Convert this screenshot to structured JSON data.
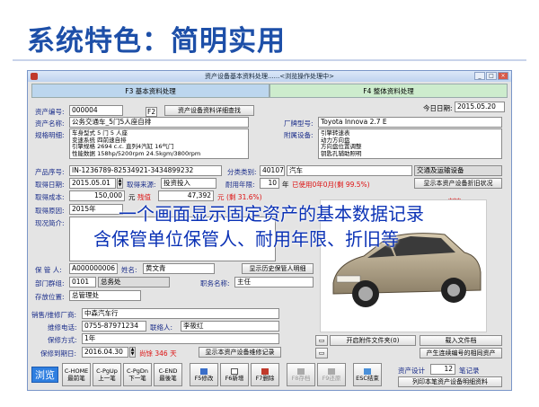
{
  "slide": {
    "title": "系统特色：简明实用"
  },
  "window": {
    "title": "资产设备基本资料处理......<浏览操作处理中>",
    "controls": [
      "_",
      "□",
      "×"
    ]
  },
  "tabs": {
    "basic": "F3 基本资料处理",
    "overall": "F4 整体资料处理"
  },
  "form": {
    "today_label": "今日日期:",
    "today_value": "2015.05.20",
    "asset_no_label": "资产编号:",
    "asset_no_value": "000004",
    "f2_label": "F2",
    "detail_query_btn": "资产设备资料详细查找",
    "asset_name_label": "资产名称:",
    "asset_name_value": "公务交通车_5门5人座自排",
    "brand_label": "厂牌型号:",
    "brand_value": "Toyota Innova 2.7 E",
    "spec_label": "规格明细:",
    "spec_lines": [
      "车身型式 5 门 5 人座",
      "变速系统 四前速自排",
      "引擎规格 2694 c.c. 直列4汽缸 16气门",
      "性能数据 158hp/5200rpm 24.5kgm/3800rpm"
    ],
    "accessory_label": "附属设备:",
    "accessory_lines": [
      "引擎转速表",
      "动力方向盘",
      "方向盘位置调整",
      "钥匙孔辅助照明"
    ],
    "serial_label": "产品序号:",
    "serial_value": "IN-1236789-82534921-3434899232",
    "category_label": "分类类别:",
    "category_code": "40107",
    "category_name": "汽车",
    "category_group": "交通及运输设备",
    "acq_date_label": "取得日期:",
    "acq_date_value": "2015.05.01",
    "acq_source_label": "取得来源:",
    "acq_source_value": "投资投入",
    "life_label": "耐用年限:",
    "life_value": "10",
    "life_unit": "年",
    "life_used": "已使用0年0月(剩 99.5%)",
    "show_depr_btn": "显示本资产设备折旧状况",
    "cost_label": "取得成本:",
    "cost_value": "150,000",
    "cost_unit": "元",
    "cost_extra": "残值",
    "residual_value": "47,392",
    "residual_unit": "元",
    "residual_pct": "(剩 31.6%)",
    "reason_label": "取得原因:",
    "reason_value": "2015年",
    "stars": "***",
    "status_label": "现况简介:",
    "keeper_label": "保 管 人:",
    "keeper_value": "A000000006",
    "name_label": "姓名:",
    "name_value": "黄文青",
    "history_btn": "显示历史保管人明细",
    "dept_label": "部门群组:",
    "dept_code": "0101",
    "dept_name": "总务处",
    "title_label": "职务名称:",
    "title_value": "主任",
    "location_label": "存放位置:",
    "location_value": "总管理处",
    "vendor_label": "销售/维修厂商:",
    "vendor_value": "中森汽车行",
    "phone_label": "维修电话:",
    "phone_value": "0755-87971234",
    "contact_label": "联络人:",
    "contact_value": "李筱红",
    "warranty_label": "保修方式:",
    "warranty_value": "1年",
    "warranty_end_label": "保修到期日:",
    "warranty_end_value": "2016.04.30",
    "warranty_remaining": "尚馀 346 天",
    "show_repair_btn": "显示本资产设备维修记录",
    "open_attach_btn": "开启附件文件夹(0)",
    "load_file_btn": "载入文件档",
    "barcode_btn": "产生连续编号的相同资产",
    "total_label": "资产设计",
    "total_value": "12",
    "total_unit": "笔记录",
    "print_btn": "列印本笔资产设备明细资料"
  },
  "overlay": {
    "line1": "一个画面显示固定资产的基本数据记录",
    "line2": "含保管单位保管人、耐用年限、折旧等"
  },
  "toolbar": {
    "browse": "浏览",
    "buttons": [
      {
        "line1": "C-HOME",
        "line2": "最前笔"
      },
      {
        "line1": "C-PgUp",
        "line2": "上一笔"
      },
      {
        "line1": "C-PgDn",
        "line2": "下一笔"
      },
      {
        "line1": "C-END",
        "line2": "最後笔"
      },
      {
        "line1": "",
        "line2": "F5修改"
      },
      {
        "line1": "",
        "line2": "F6新增"
      },
      {
        "line1": "",
        "line2": "F7删除"
      },
      {
        "line1": "",
        "line2": "F8存档"
      },
      {
        "line1": "",
        "line2": "F9还原"
      },
      {
        "line1": "",
        "line2": "ESC结束"
      }
    ]
  },
  "colors": {
    "title_blue": "#1d4fa8",
    "overlay_blue": "#0a31b5",
    "tab_blue": "#bcd6ee",
    "tab_green": "#cdeccd"
  }
}
